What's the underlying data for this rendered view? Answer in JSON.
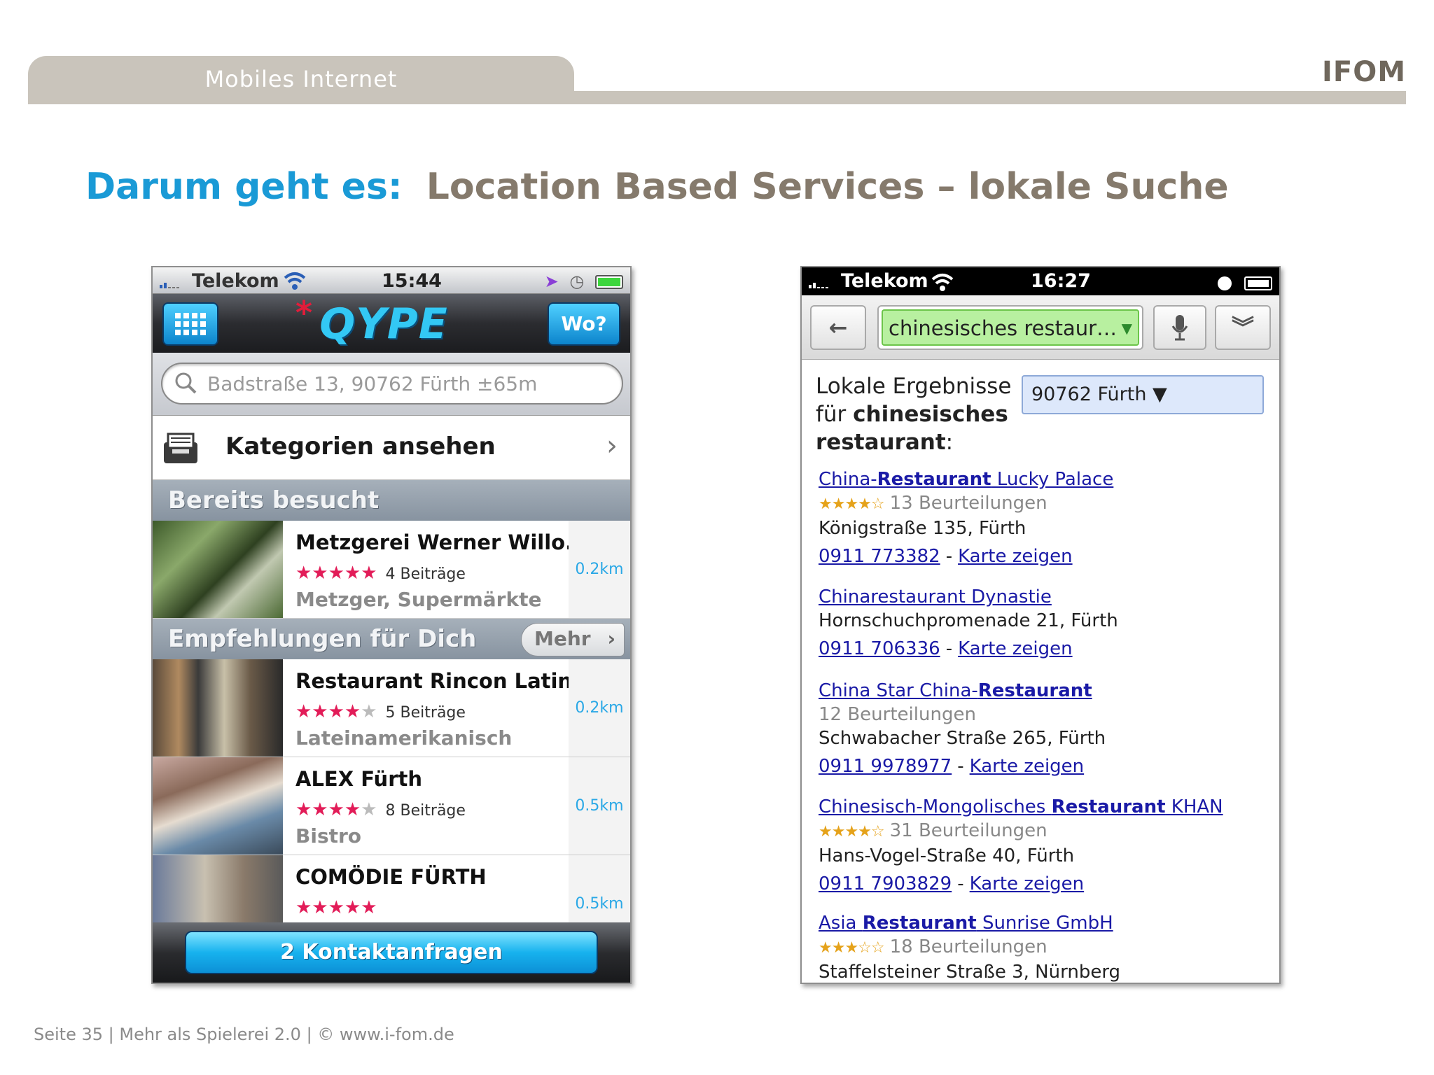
{
  "header": {
    "tab_label": "Mobiles Internet",
    "logo": "IFOM"
  },
  "title": {
    "lead": "Darum geht es:",
    "rest": "Location Based Services – lokale Suche"
  },
  "footer": {
    "text": "Seite 35  |  Mehr als Spielerei 2.0  |  © www.i-fom.de"
  },
  "qype": {
    "status": {
      "carrier": "Telekom",
      "time": "15:44"
    },
    "app_name": "QYPE",
    "wo_button": "Wo?",
    "search_value": "Badstraße 13, 90762 Fürth ±65m",
    "categories_label": "Kategorien ansehen",
    "section_visited": "Bereits besucht",
    "section_recommend": "Empfehlungen für Dich",
    "mehr_label": "Mehr",
    "items": [
      {
        "name": "Metzgerei Werner Willo...",
        "stars": 5,
        "count": "4 Beiträge",
        "category": "Metzger, Supermärkte",
        "dist": "0.2km"
      },
      {
        "name": "Restaurant Rincon Latino",
        "stars": 4,
        "count": "5 Beiträge",
        "category": "Lateinamerikanisch",
        "dist": "0.2km"
      },
      {
        "name": "ALEX Fürth",
        "stars": 4,
        "count": "8 Beiträge",
        "category": "Bistro",
        "dist": "0.5km"
      },
      {
        "name": "COMÖDIE FÜRTH",
        "stars": 5,
        "count": "",
        "category": "",
        "dist": "0.5km"
      }
    ],
    "contact_button": "2 Kontaktanfragen",
    "colors": {
      "accent": "#1ab4ee",
      "stars": "#e21c58"
    }
  },
  "google": {
    "status": {
      "carrier": "Telekom",
      "time": "16:27"
    },
    "search_value": "chinesisches restaur…",
    "header_line1": "Lokale Ergebnisse",
    "header_line2_pre": "für ",
    "header_line2_bold": "chinesisches",
    "header_line3_bold": "restaurant",
    "header_line3_post": ":",
    "location": "90762 Fürth ▼",
    "map_link": "Karte zeigen",
    "results": [
      {
        "pre": "China-",
        "bold": "Restaurant",
        "post": " Lucky Palace",
        "rating": "★★★★☆",
        "reviews": "13 Beurteilungen",
        "address": "Königstraße 135, Fürth",
        "phone": "0911 773382"
      },
      {
        "pre": "Chinarestaurant Dynastie",
        "bold": "",
        "post": "",
        "rating": "",
        "reviews": "",
        "address": "Hornschuchpromenade 21, Fürth",
        "phone": "0911 706336"
      },
      {
        "pre": "China Star China-",
        "bold": "Restaurant",
        "post": "",
        "rating": "",
        "reviews": "12 Beurteilungen",
        "address": "Schwabacher Straße 265, Fürth",
        "phone": "0911 9978977"
      },
      {
        "pre": "Chinesisch-Mongolisches ",
        "bold": "Restaurant",
        "post": " KHAN",
        "rating": "★★★★☆",
        "reviews": "31 Beurteilungen",
        "address": "Hans-Vogel-Straße 40, Fürth",
        "phone": "0911 7903829"
      },
      {
        "pre": "Asia ",
        "bold": "Restaurant",
        "post": " Sunrise GmbH",
        "rating": "★★★☆☆",
        "reviews": "18 Beurteilungen",
        "address": "Staffelsteiner Straße 3, Nürnberg",
        "phone": ""
      }
    ],
    "colors": {
      "link": "#1a1aa6",
      "search_bg": "#b8f0a0"
    }
  }
}
